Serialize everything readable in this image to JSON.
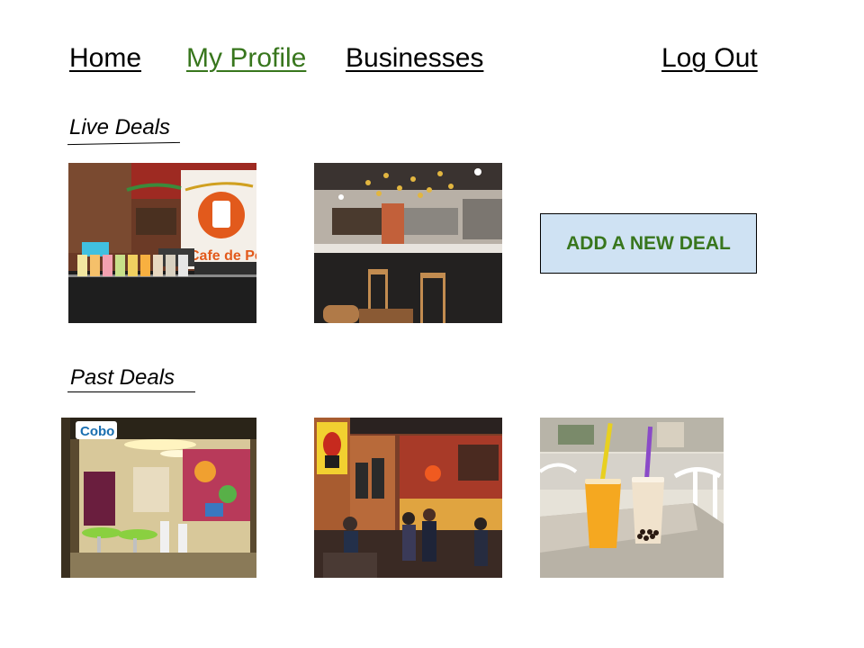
{
  "nav": {
    "home": "Home",
    "my_profile": "My Profile",
    "businesses": "Businesses",
    "log_out": "Log Out"
  },
  "live_deals": {
    "heading": "Live Deals",
    "add_button_label": "ADD A NEW DEAL",
    "photos": [
      "cafe-counter-drinks-photo",
      "cafe-bar-interior-photo"
    ],
    "sign_text": "Cafe de Pe"
  },
  "past_deals": {
    "heading": "Past Deals",
    "photos": [
      "cobo-storefront-photo",
      "coffee-shop-interior-photo",
      "bubble-tea-cups-photo"
    ],
    "sign_text": "Cobo"
  },
  "colors": {
    "active_link": "#38761d",
    "button_bg": "#cfe2f3",
    "button_text": "#38761d"
  }
}
